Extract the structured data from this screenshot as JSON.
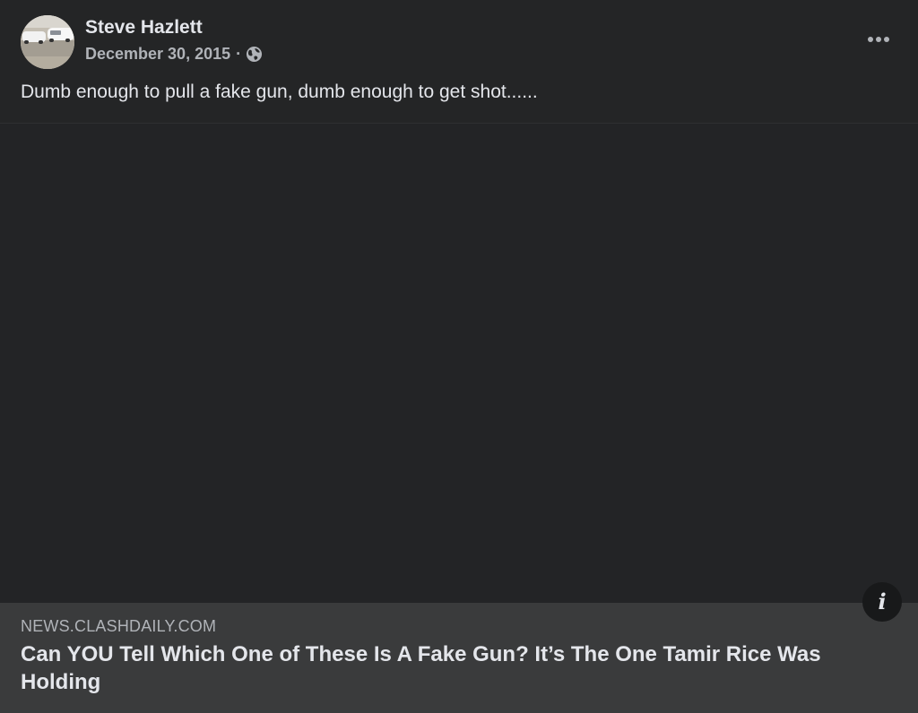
{
  "post": {
    "author": "Steve Hazlett",
    "date": "December 30, 2015",
    "separator": "·",
    "audience_icon": "globe-icon",
    "more_icon": "more-options-icon",
    "text": "Dumb enough to pull a fake gun, dumb enough to get shot......"
  },
  "link_preview": {
    "domain": "NEWS.CLASHDAILY.COM",
    "headline": "Can YOU Tell Which One of These Is A Fake Gun? It’s The One Tamir Rice Was Holding",
    "info_icon_glyph": "i"
  },
  "colors": {
    "background": "#242526",
    "primary_text": "#e4e6eb",
    "secondary_text": "#b0b3b8",
    "footer_background": "#3a3b3c"
  }
}
